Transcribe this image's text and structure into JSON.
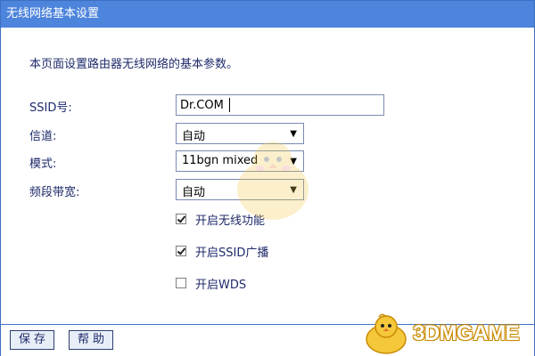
{
  "title": "无线网络基本设置",
  "description": "本页面设置路由器无线网络的基本参数。",
  "ssid": {
    "label": "SSID号:",
    "value": "Dr.COM"
  },
  "channel": {
    "label": "信道:",
    "value": "自动"
  },
  "mode": {
    "label": "模式:",
    "value": "11bgn mixed"
  },
  "bandwidth": {
    "label": "频段带宽:",
    "value": "自动"
  },
  "options": [
    {
      "label": "开启无线功能",
      "checked": true
    },
    {
      "label": "开启SSID广播",
      "checked": true
    },
    {
      "label": "开启WDS",
      "checked": false
    }
  ],
  "buttons": {
    "save": "保存",
    "help": "帮助"
  },
  "watermark": {
    "logo_text": "3DMGAME"
  },
  "colors": {
    "title_bar": "#4d84dc",
    "frame_border": "#3d70c0",
    "label_text": "#1e2a6a"
  }
}
